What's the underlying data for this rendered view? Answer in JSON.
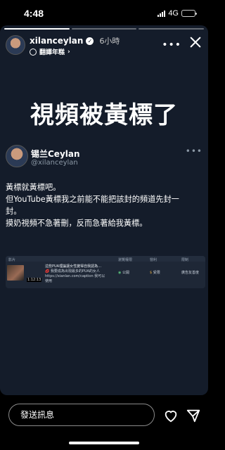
{
  "status_bar": {
    "time": "4:48",
    "network": "4G"
  },
  "story": {
    "segments_total": 3,
    "segments_done": 1,
    "username": "xilanceylan",
    "time_ago": "6小時",
    "translate_label": "翻譯年糕",
    "title": "視頻被黃標了"
  },
  "tweet": {
    "display_name": "锡兰Ceylan",
    "handle": "@xilanceylan",
    "lines": [
      "黃標就黃標吧。",
      "但YouTube黃標我之前能不能把該封的頻道先封一",
      "封。",
      "摸奶視頻不急著刪，反而急著給我黃標。"
    ]
  },
  "embed": {
    "headers": [
      "影片",
      "瀏覽權限",
      "限制",
      "營利",
      "限制"
    ],
    "video_title": "這些PUA理論讓女性變得自我認為…",
    "video_desc": "💋 我要成為出現最多的PUA的女人",
    "video_url": "https://xianlan.com/caption 我可以使用",
    "thumb_label": "1:12:13",
    "visibility": "公開",
    "monetization": "受限",
    "restriction": "廣告友善度"
  },
  "reply": {
    "placeholder": "發送訊息"
  },
  "colors": {
    "story_bg": "#141c2a",
    "page_bg": "#000000"
  }
}
